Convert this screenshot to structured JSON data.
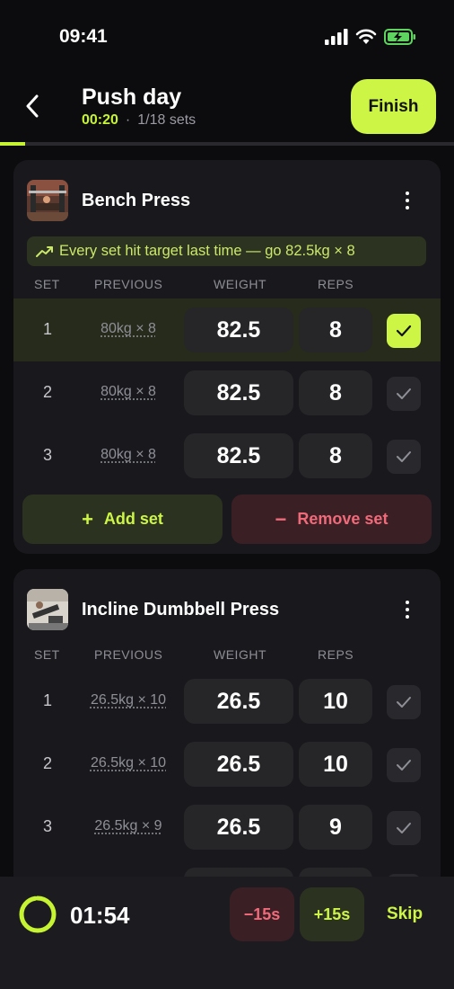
{
  "status": {
    "time": "09:41"
  },
  "header": {
    "title": "Push day",
    "elapsed": "00:20",
    "separator": "·",
    "sets_progress": "1/18 sets",
    "finish_label": "Finish",
    "progress_fraction": 0.056
  },
  "exercises": [
    {
      "name": "Bench Press",
      "hint": "Every set hit target last time — go 82.5kg × 8",
      "columns": {
        "set": "SET",
        "previous": "PREVIOUS",
        "weight": "WEIGHT",
        "reps": "REPS"
      },
      "sets": [
        {
          "num": "1",
          "previous": "80kg × 8",
          "weight": "82.5",
          "reps": "8",
          "done": true
        },
        {
          "num": "2",
          "previous": "80kg × 8",
          "weight": "82.5",
          "reps": "8",
          "done": false
        },
        {
          "num": "3",
          "previous": "80kg × 8",
          "weight": "82.5",
          "reps": "8",
          "done": false
        }
      ],
      "add_label": "Add set",
      "remove_label": "Remove set"
    },
    {
      "name": "Incline Dumbbell Press",
      "columns": {
        "set": "SET",
        "previous": "PREVIOUS",
        "weight": "WEIGHT",
        "reps": "REPS"
      },
      "sets": [
        {
          "num": "1",
          "previous": "26.5kg × 10",
          "weight": "26.5",
          "reps": "10",
          "done": false
        },
        {
          "num": "2",
          "previous": "26.5kg × 10",
          "weight": "26.5",
          "reps": "10",
          "done": false
        },
        {
          "num": "3",
          "previous": "26.5kg × 9",
          "weight": "26.5",
          "reps": "9",
          "done": false
        }
      ]
    }
  ],
  "rest": {
    "time": "01:54",
    "minus_label": "−15s",
    "plus_label": "+15s",
    "skip_label": "Skip"
  },
  "colors": {
    "accent": "#cdf545",
    "danger": "#f06a7a",
    "background": "#0c0c0e",
    "card": "#19191d"
  }
}
